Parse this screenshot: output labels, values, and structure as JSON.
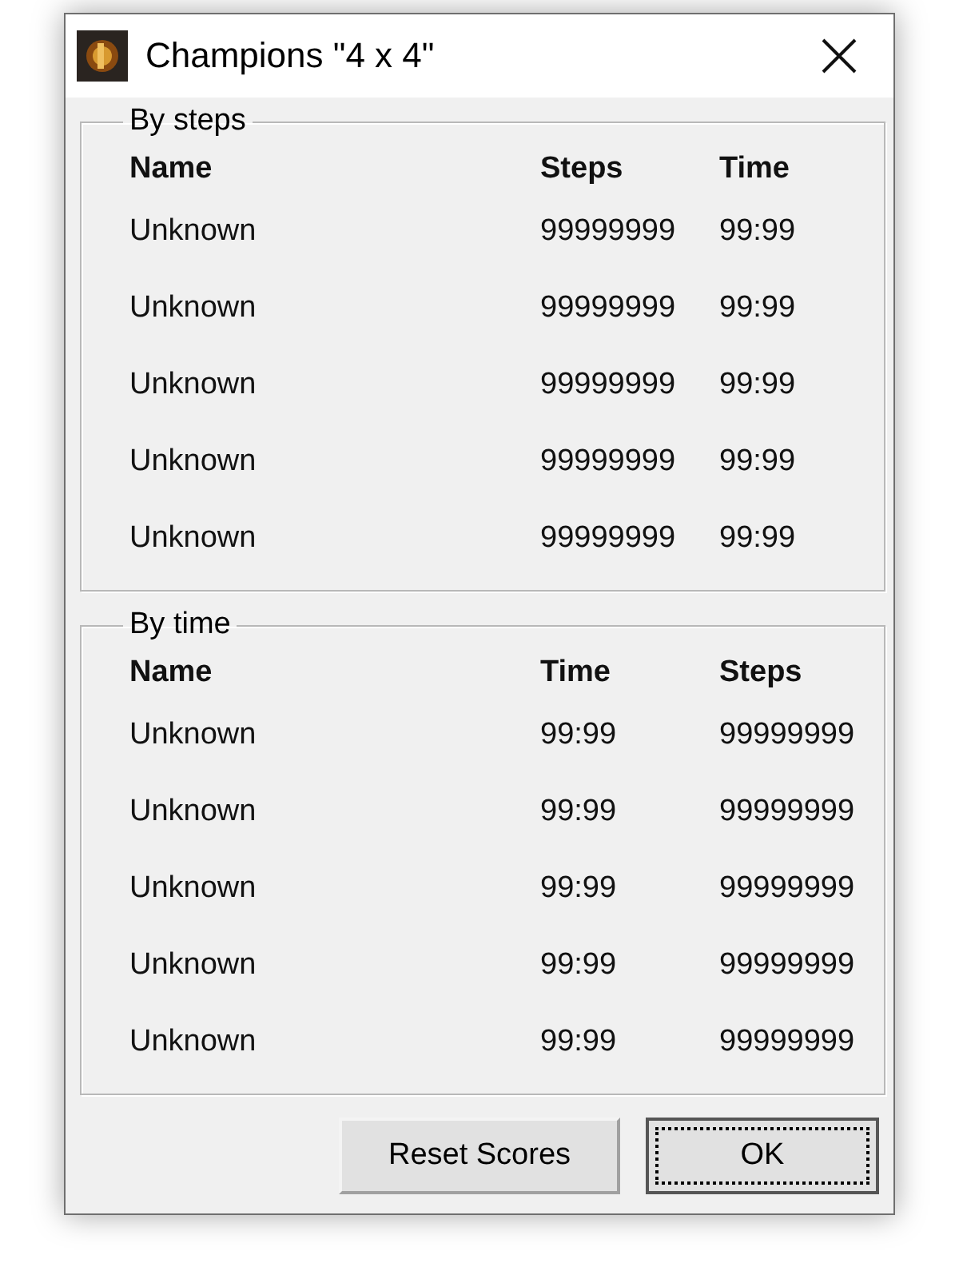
{
  "window": {
    "title": "Champions \"4 x 4\""
  },
  "groups": [
    {
      "title": "By steps",
      "columns": [
        "Name",
        "Steps",
        "Time"
      ],
      "rows": [
        [
          "Unknown",
          "99999999",
          "99:99"
        ],
        [
          "Unknown",
          "99999999",
          "99:99"
        ],
        [
          "Unknown",
          "99999999",
          "99:99"
        ],
        [
          "Unknown",
          "99999999",
          "99:99"
        ],
        [
          "Unknown",
          "99999999",
          "99:99"
        ]
      ]
    },
    {
      "title": "By time",
      "columns": [
        "Name",
        "Time",
        "Steps"
      ],
      "rows": [
        [
          "Unknown",
          "99:99",
          "99999999"
        ],
        [
          "Unknown",
          "99:99",
          "99999999"
        ],
        [
          "Unknown",
          "99:99",
          "99999999"
        ],
        [
          "Unknown",
          "99:99",
          "99999999"
        ],
        [
          "Unknown",
          "99:99",
          "99999999"
        ]
      ]
    }
  ],
  "buttons": [
    {
      "label": "Reset Scores",
      "default": false
    },
    {
      "label": "OK",
      "default": true
    }
  ]
}
